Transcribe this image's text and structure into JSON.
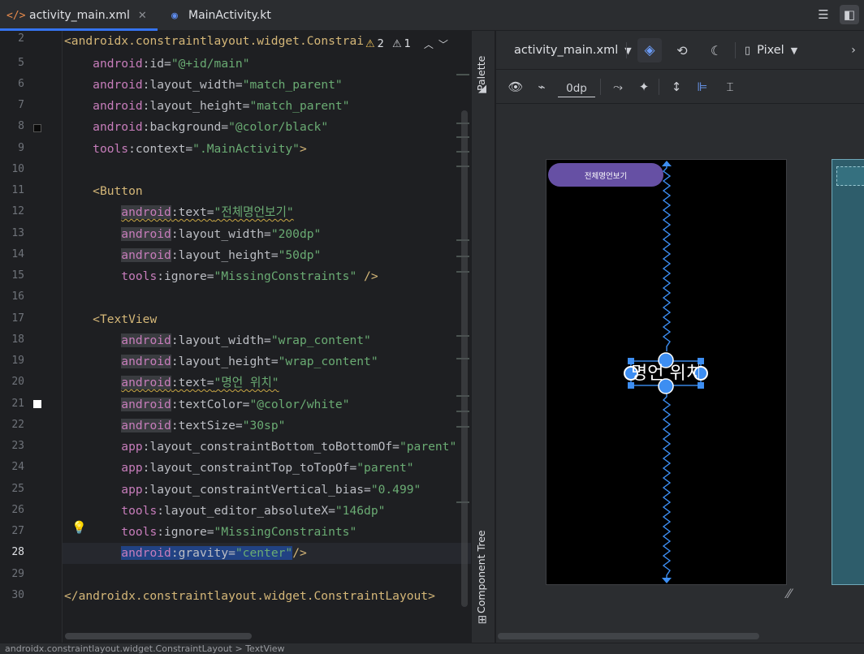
{
  "tabs": [
    {
      "label": "activity_main.xml",
      "icon": "xml-file-icon"
    },
    {
      "label": "MainActivity.kt",
      "icon": "kotlin-file-icon"
    }
  ],
  "inspection": {
    "warnings": "2",
    "weak_warnings": "1"
  },
  "editor": {
    "line_numbers": [
      "2",
      "5",
      "6",
      "7",
      "8",
      "9",
      "10",
      "11",
      "12",
      "13",
      "14",
      "15",
      "16",
      "17",
      "18",
      "19",
      "20",
      "21",
      "22",
      "23",
      "24",
      "25",
      "26",
      "27",
      "28",
      "29",
      "30"
    ],
    "current_line": "28",
    "code": {
      "l2": {
        "open": "<",
        "tag": "androidx.constraintlayout.widget.Constrai"
      },
      "l5": {
        "prefix": "android",
        "attr": ":id=",
        "value": "\"@+id/main\""
      },
      "l6": {
        "prefix": "android",
        "attr": ":layout_width=",
        "value": "\"match_parent\""
      },
      "l7": {
        "prefix": "android",
        "attr": ":layout_height=",
        "value": "\"match_parent\""
      },
      "l8": {
        "prefix": "android",
        "attr": ":background=",
        "value": "\"@color/black\""
      },
      "l9": {
        "prefix": "tools",
        "attr": ":context=",
        "value": "\".MainActivity\"",
        "end": ">"
      },
      "l11": {
        "tag": "<Button"
      },
      "l12": {
        "prefix": "android",
        "attr": ":text=",
        "value": "\"전체명언보기\""
      },
      "l13": {
        "prefix": "android",
        "attr": ":layout_width=",
        "value": "\"200dp\""
      },
      "l14": {
        "prefix": "android",
        "attr": ":layout_height=",
        "value": "\"50dp\""
      },
      "l15": {
        "prefix": "tools",
        "attr": ":ignore=",
        "value": "\"MissingConstraints\"",
        "end": " />"
      },
      "l17": {
        "tag": "<TextView"
      },
      "l18": {
        "prefix": "android",
        "attr": ":layout_width=",
        "value": "\"wrap_content\""
      },
      "l19": {
        "prefix": "android",
        "attr": ":layout_height=",
        "value": "\"wrap_content\""
      },
      "l20": {
        "prefix": "android",
        "attr": ":text=",
        "value": "\"명언 위치\""
      },
      "l21": {
        "prefix": "android",
        "attr": ":textColor=",
        "value": "\"@color/white\""
      },
      "l22": {
        "prefix": "android",
        "attr": ":textSize=",
        "value": "\"30sp\""
      },
      "l23": {
        "prefix": "app",
        "attr": ":layout_constraintBottom_toBottomOf=",
        "value": "\"parent\""
      },
      "l24": {
        "prefix": "app",
        "attr": ":layout_constraintTop_toTopOf=",
        "value": "\"parent\""
      },
      "l25": {
        "prefix": "app",
        "attr": ":layout_constraintVertical_bias=",
        "value": "\"0.499\""
      },
      "l26": {
        "prefix": "tools",
        "attr": ":layout_editor_absoluteX=",
        "value": "\"146dp\""
      },
      "l27": {
        "prefix": "tools",
        "attr": ":ignore=",
        "value": "\"MissingConstraints\""
      },
      "l28": {
        "prefix": "android",
        "attr": ":gravity=",
        "value": "\"center\"",
        "end": "/>"
      },
      "l30": {
        "tag": "</androidx.constraintlayout.widget.ConstraintLayout>"
      }
    }
  },
  "side": {
    "palette": "Palette",
    "component_tree": "Component Tree"
  },
  "design": {
    "file_selector": "activity_main.xml",
    "device": "Pixel",
    "default_margin": "0dp",
    "preview_button": "전체명언보기",
    "preview_text": "명언 위치"
  },
  "colors": {
    "accent": "#3574f0",
    "button": "#6650a4",
    "constraint": "#3d8ef2"
  },
  "statusbar": "androidx.constraintlayout.widget.ConstraintLayout > TextView"
}
